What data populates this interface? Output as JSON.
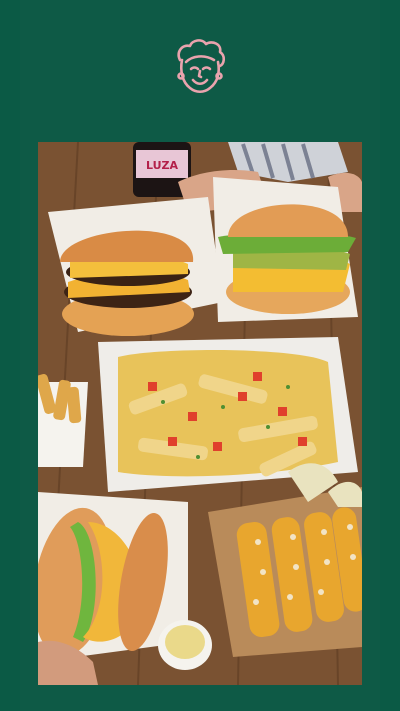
{
  "app": {
    "brand_icon": "smiling-face-logo-icon"
  },
  "theme": {
    "background": "#0e5a46",
    "sidebar": "#0b5a45",
    "logo_stroke": "#e9a3ad"
  },
  "photo": {
    "subject": "food-spread",
    "bottle_label": "LUZA"
  }
}
